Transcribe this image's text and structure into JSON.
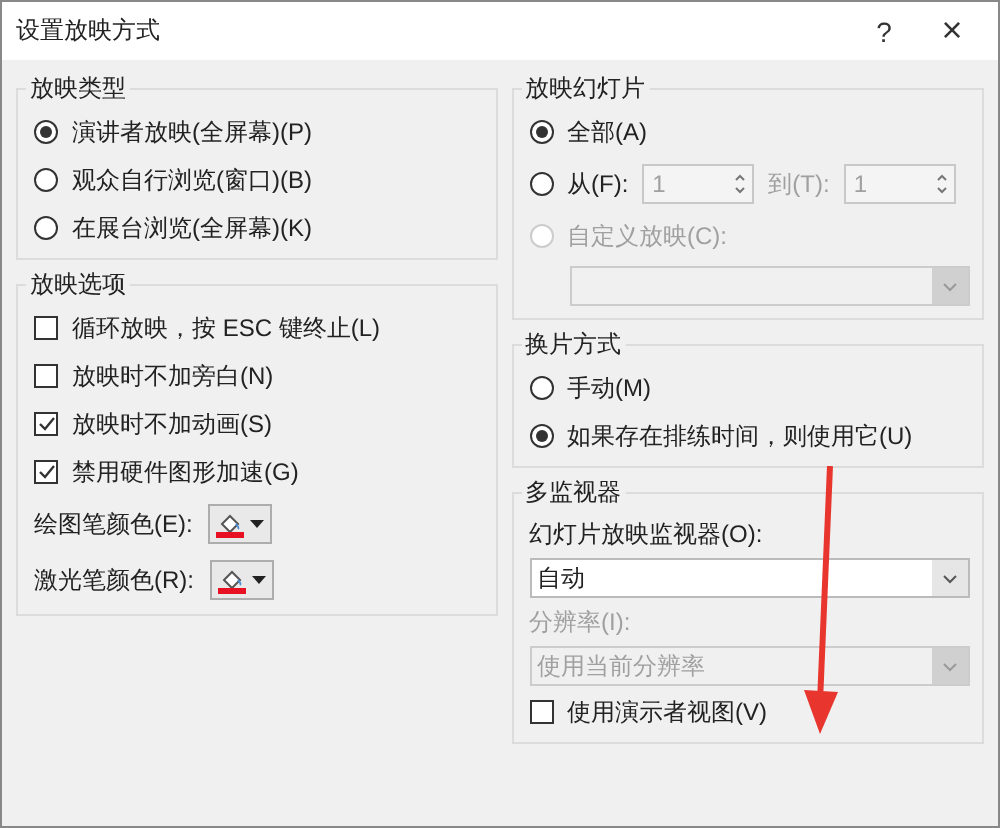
{
  "window": {
    "title": "设置放映方式",
    "help": "?",
    "close": "×"
  },
  "show_type": {
    "title": "放映类型",
    "options": [
      {
        "label": "演讲者放映(全屏幕)(P)",
        "selected": true
      },
      {
        "label": "观众自行浏览(窗口)(B)",
        "selected": false
      },
      {
        "label": "在展台浏览(全屏幕)(K)",
        "selected": false
      }
    ]
  },
  "show_options": {
    "title": "放映选项",
    "checkboxes": [
      {
        "label": "循环放映，按 ESC 键终止(L)",
        "checked": false
      },
      {
        "label": "放映时不加旁白(N)",
        "checked": false
      },
      {
        "label": "放映时不加动画(S)",
        "checked": true
      },
      {
        "label": "禁用硬件图形加速(G)",
        "checked": true
      }
    ],
    "colors": [
      {
        "label": "绘图笔颜色(E):",
        "color": "#e81123"
      },
      {
        "label": "激光笔颜色(R):",
        "color": "#e81123"
      }
    ]
  },
  "slides": {
    "title": "放映幻灯片",
    "options": [
      {
        "kind": "all",
        "label": "全部(A)",
        "selected": true,
        "disabled": false
      },
      {
        "kind": "range",
        "label": "从(F):",
        "selected": false,
        "disabled": false,
        "from": "1",
        "to_label": "到(T):",
        "to": "1"
      },
      {
        "kind": "custom",
        "label": "自定义放映(C):",
        "selected": false,
        "disabled": true
      }
    ]
  },
  "advance": {
    "title": "换片方式",
    "options": [
      {
        "label": "手动(M)",
        "selected": false
      },
      {
        "label": "如果存在排练时间，则使用它(U)",
        "selected": true
      }
    ]
  },
  "monitors": {
    "title": "多监视器",
    "monitor_label": "幻灯片放映监视器(O):",
    "monitor_value": "自动",
    "resolution_label": "分辨率(I):",
    "resolution_value": "使用当前分辨率",
    "resolution_disabled": true,
    "presenter_view": {
      "label": "使用演示者视图(V)",
      "checked": false
    }
  }
}
